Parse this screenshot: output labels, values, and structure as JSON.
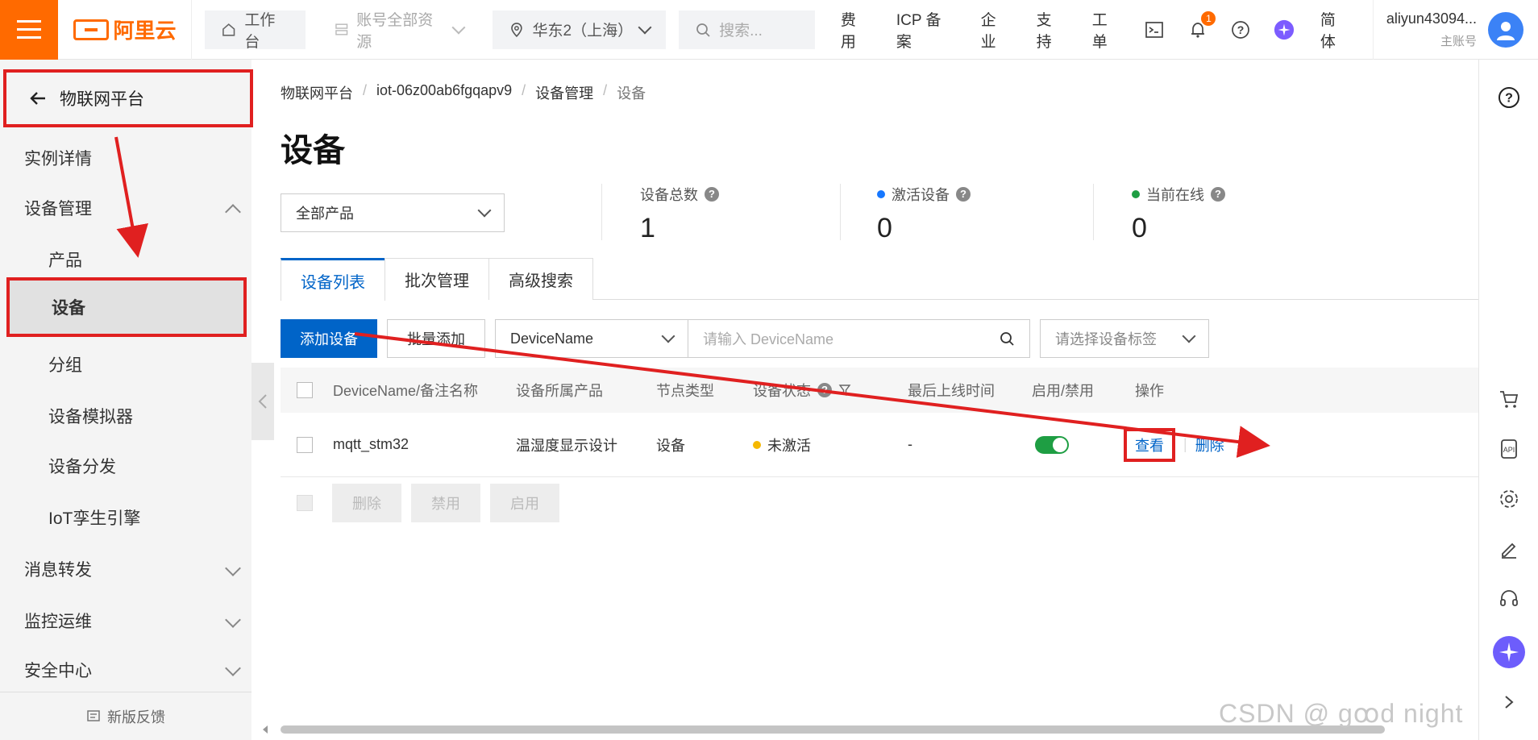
{
  "brand": {
    "name": "阿里云"
  },
  "topbar": {
    "workbench": "工作台",
    "resources": "账号全部资源",
    "region": "华东2（上海）",
    "search_placeholder": "搜索...",
    "links": [
      "费用",
      "ICP 备案",
      "企业",
      "支持",
      "工单"
    ],
    "notification_count": "1",
    "language": "简体",
    "username": "aliyun43094...",
    "account_type": "主账号"
  },
  "sidebar": {
    "back_label": "物联网平台",
    "items": [
      {
        "label": "实例详情"
      },
      {
        "label": "设备管理"
      },
      {
        "label": "产品"
      },
      {
        "label": "设备"
      },
      {
        "label": "分组"
      },
      {
        "label": "设备模拟器"
      },
      {
        "label": "设备分发"
      },
      {
        "label": "IoT孪生引擎"
      },
      {
        "label": "消息转发"
      },
      {
        "label": "监控运维"
      },
      {
        "label": "安全中心"
      }
    ],
    "feedback": "新版反馈"
  },
  "breadcrumb": [
    "物联网平台",
    "iot-06z00ab6fgqapv9",
    "设备管理",
    "设备"
  ],
  "page": {
    "title": "设备"
  },
  "filter": {
    "product": "全部产品"
  },
  "stats": [
    {
      "label": "设备总数",
      "value": "1",
      "color": ""
    },
    {
      "label": "激活设备",
      "value": "0",
      "color": "#1677ff"
    },
    {
      "label": "当前在线",
      "value": "0",
      "color": "#1e9e43"
    }
  ],
  "tabs": [
    "设备列表",
    "批次管理",
    "高级搜索"
  ],
  "toolbar": {
    "add_device": "添加设备",
    "bulk_add": "批量添加",
    "field_select": "DeviceName",
    "search_placeholder": "请输入 DeviceName",
    "tag_placeholder": "请选择设备标签"
  },
  "table": {
    "headers": [
      "DeviceName/备注名称",
      "设备所属产品",
      "节点类型",
      "设备状态",
      "最后上线时间",
      "启用/禁用",
      "操作"
    ],
    "rows": [
      {
        "name": "mqtt_stm32",
        "product": "温湿度显示设计",
        "node_type": "设备",
        "status": "未激活",
        "status_color": "#f5b800",
        "last_online": "-",
        "enabled": true,
        "actions": [
          "查看",
          "删除"
        ]
      }
    ],
    "footer_actions": [
      "删除",
      "禁用",
      "启用"
    ]
  },
  "watermark": "CSDN @    ɡꝏԁ niɡht"
}
